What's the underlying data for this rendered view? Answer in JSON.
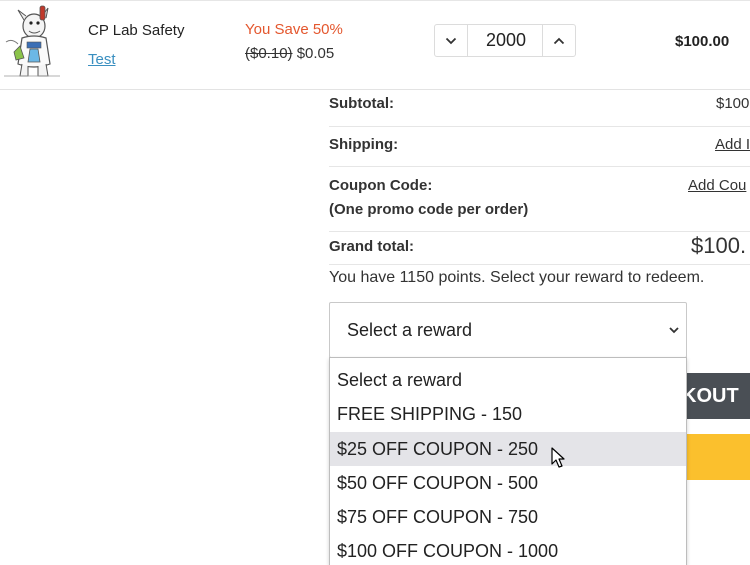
{
  "cart_item": {
    "product_name": "CP Lab Safety",
    "variant_link": "Test",
    "discount_text": "You Save 50%",
    "original_price": "($0.10)",
    "sale_price": "$0.05",
    "quantity": "2000",
    "line_total": "$100.00"
  },
  "summary": {
    "subtotal_label": "Subtotal:",
    "subtotal_value": "$100",
    "shipping_label": "Shipping:",
    "shipping_link": "Add I",
    "coupon_label": "Coupon Code:",
    "coupon_note": "(One promo code per order)",
    "coupon_link": "Add Cou",
    "grand_total_label": "Grand total:",
    "grand_total_value": "$100."
  },
  "rewards": {
    "points_text": "You have 1150 points. Select your reward to redeem.",
    "selected": "Select a reward",
    "options": [
      "Select a reward",
      "FREE SHIPPING - 150",
      "$25 OFF COUPON - 250",
      "$50 OFF COUPON - 500",
      "$75 OFF COUPON - 750",
      "$100 OFF COUPON - 1000"
    ],
    "highlighted_index": 2
  },
  "checkout": {
    "label": "KOUT"
  },
  "colors": {
    "discount": "#e4572e",
    "link": "#3a8fc0",
    "checkout_bg": "#4a4f55",
    "secondary_button_bg": "#fbc02d",
    "option_highlight": "#e4e4e8"
  },
  "icons": {
    "product_thumbnail": "mascot-image",
    "qty_minus": "chevron-down-icon",
    "qty_plus": "chevron-up-icon",
    "select_arrow": "chevron-down-icon",
    "pointer": "mouse-cursor-icon"
  }
}
